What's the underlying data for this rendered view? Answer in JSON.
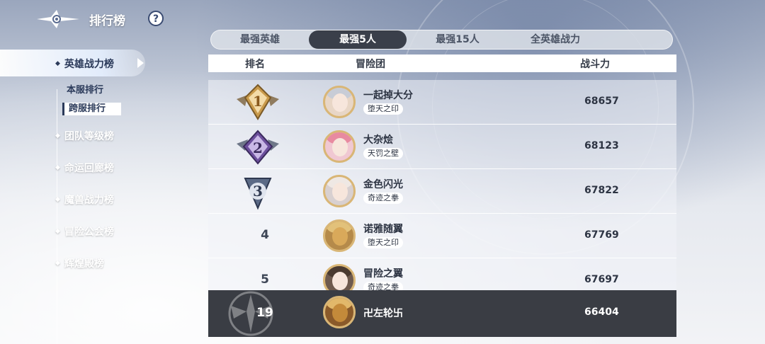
{
  "header": {
    "title": "排行榜",
    "help_label": "?"
  },
  "sidebar": {
    "items": [
      {
        "label": "英雄战力榜",
        "active": true
      },
      {
        "label": "团队等级榜"
      },
      {
        "label": "命运回廊榜"
      },
      {
        "label": "魔兽战力榜"
      },
      {
        "label": "冒险公会榜"
      },
      {
        "label": "辉煌殿榜"
      }
    ],
    "sub_items": [
      {
        "label": "本服排行"
      },
      {
        "label": "跨服排行",
        "selected": true
      }
    ]
  },
  "tabs": [
    {
      "label": "最强英雄"
    },
    {
      "label": "最强5人",
      "active": true
    },
    {
      "label": "最强15人"
    },
    {
      "label": "全英雄战力"
    }
  ],
  "table": {
    "headers": {
      "rank": "排名",
      "team": "冒险团",
      "power": "战斗力"
    },
    "rows": [
      {
        "rank": "1",
        "name": "一起掉大分",
        "guild": "堕天之印",
        "power": "68657"
      },
      {
        "rank": "2",
        "name": "大杂烩",
        "guild": "天罚之壁",
        "power": "68123"
      },
      {
        "rank": "3",
        "name": "金色闪光",
        "guild": "奇迹之拳",
        "power": "67822"
      },
      {
        "rank": "4",
        "name": "诺雅随翼",
        "guild": "堕天之印",
        "power": "67769"
      },
      {
        "rank": "5",
        "name": "冒险之翼",
        "guild": "奇迹之拳",
        "power": "67697"
      }
    ]
  },
  "self": {
    "rank": "19",
    "name": "卍左轮卐",
    "power": "66404"
  },
  "colors": {
    "gold_badge": "#c99a4b",
    "purple_badge": "#6c4f9c",
    "silver_badge": "#5b6a86",
    "tab_active": "#3a3f4a",
    "self_row": "#3a3d44"
  }
}
